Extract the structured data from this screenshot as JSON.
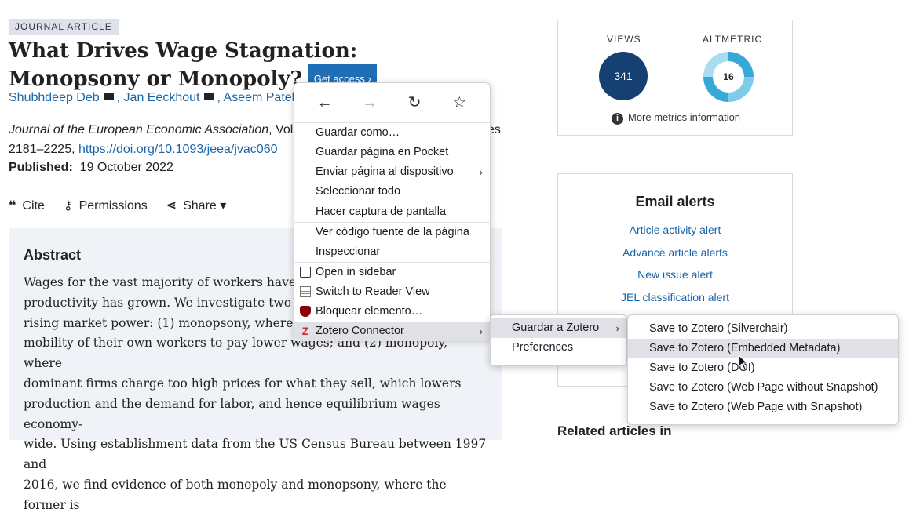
{
  "article": {
    "badge": "JOURNAL ARTICLE",
    "title": "What Drives Wage Stagnation: Monopsony or Monopoly?",
    "get_access": "Get access",
    "authors": [
      "Shubhdeep Deb",
      "Jan Eeckhout",
      "Aseem Patel"
    ],
    "journal_name": "Journal of the European Economic Association",
    "journal_rest": ", Volume",
    "journal_tail": "es",
    "pages": "2181–2225, ",
    "doi": "https://doi.org/10.1093/jeea/jvac060",
    "published_label": "Published:",
    "published_date": "19 October 2022"
  },
  "tools": {
    "cite": "Cite",
    "permissions": "Permissions",
    "share": "Share"
  },
  "abstract": {
    "heading": "Abstract",
    "lines": [
      "Wages for the vast majority of workers have sta",
      "productivity has grown. We investigate two co",
      "rising market power: (1) monopsony, where do",
      "mobility of their own workers to pay lower wages; and (2) monopoly, where",
      "dominant firms charge too high prices for what they sell, which lowers",
      "production and the demand for labor, and hence equilibrium wages economy-",
      "wide. Using establishment data from the US Census Bureau between 1997 and",
      "2016, we find evidence of both monopoly and monopsony, where the former is"
    ]
  },
  "metrics": {
    "views_label": "VIEWS",
    "views_value": "341",
    "altmetric_label": "ALTMETRIC",
    "altmetric_value": "16",
    "more_info": "More metrics information"
  },
  "alerts": {
    "heading": "Email alerts",
    "links": [
      "Article activity alert",
      "Advance article alerts",
      "New issue alert",
      "JEL classification alert"
    ],
    "partial_w": "W"
  },
  "related": "Related articles in",
  "context_menu": {
    "items": [
      "Guardar como…",
      "Guardar página en Pocket",
      "Enviar página al dispositivo",
      "Seleccionar todo",
      "Hacer captura de pantalla",
      "Ver código fuente de la página",
      "Inspeccionar",
      "Open in sidebar",
      "Switch to Reader View",
      "Bloquear elemento…",
      "Zotero Connector"
    ]
  },
  "zotero_menu": {
    "items": [
      "Guardar a Zotero",
      "Preferences"
    ]
  },
  "save_menu": {
    "items": [
      "Save to Zotero (Silverchair)",
      "Save to Zotero (Embedded Metadata)",
      "Save to Zotero (DOI)",
      "Save to Zotero (Web Page without Snapshot)",
      "Save to Zotero (Web Page with Snapshot)"
    ]
  }
}
